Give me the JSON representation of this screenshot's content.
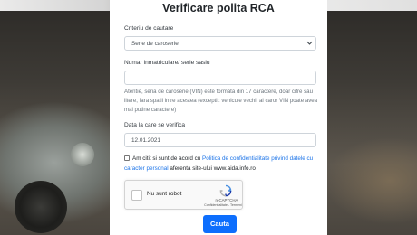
{
  "form": {
    "title": "Verificare polita RCA",
    "criteria_label": "Criteriu de cautare",
    "criteria_selected": "Serie de caroserie",
    "plate_label": "Numar inmatriculare/ serie sasiu",
    "plate_value": "",
    "vin_help": "Atentie, seria de caroserie (VIN) este formata din 17 caractere, doar cifre sau litere, fara spatii intre acestea (exceptii: vehicule vechi, al caror VIN poate avea mai putine caractere)",
    "date_label": "Data la care se verifica",
    "date_value": "12.01.2021",
    "consent_prefix": "Am citit si sunt de acord cu ",
    "consent_link": "Politica de confidentialitate privind datele cu caracter personal",
    "consent_suffix": " aferenta site-ului www.aida.info.ro",
    "submit_label": "Cauta"
  },
  "recaptcha": {
    "label": "Nu sunt robot",
    "brand": "reCAPTCHA",
    "terms": "Confidentialitate - Termeni"
  },
  "icons": {
    "dropdown": "chevron-down-icon",
    "captcha": "recaptcha-logo-icon"
  },
  "colors": {
    "accent": "#0d6efd",
    "link": "#1a73e8"
  }
}
